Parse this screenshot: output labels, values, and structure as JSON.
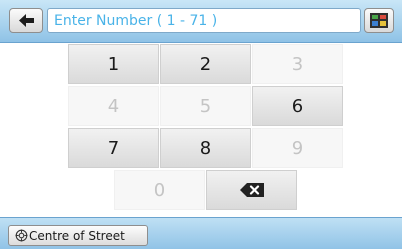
{
  "header": {
    "input_placeholder": "Enter Number ( 1 - 71 )",
    "back_icon": "back-arrow-icon",
    "map_icon": "map-view-icon"
  },
  "keypad": {
    "keys": [
      {
        "label": "1",
        "enabled": true
      },
      {
        "label": "2",
        "enabled": true
      },
      {
        "label": "3",
        "enabled": false
      },
      {
        "label": "4",
        "enabled": false
      },
      {
        "label": "5",
        "enabled": false
      },
      {
        "label": "6",
        "enabled": true
      },
      {
        "label": "7",
        "enabled": true
      },
      {
        "label": "8",
        "enabled": true
      },
      {
        "label": "9",
        "enabled": false
      },
      {
        "label": "0",
        "enabled": false
      }
    ],
    "backspace_icon": "backspace-icon"
  },
  "footer": {
    "street_button_label": "Centre of Street",
    "street_button_icon": "crosshair-icon"
  },
  "colors": {
    "bar_blue": "#a9d3ee",
    "placeholder_blue": "#49b3e8",
    "key_enabled_text": "#1a1a1a",
    "key_disabled_text": "#c4c4c4"
  }
}
